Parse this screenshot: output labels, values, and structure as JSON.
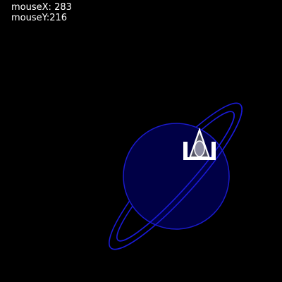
{
  "hud": {
    "mouse_x_label": "mouseX:",
    "mouse_x_value": "283",
    "mouse_y_label": "mouseY:",
    "mouse_y_value": "216"
  },
  "colors": {
    "background": "#000000",
    "planet_fill": "#000046",
    "planet_stroke": "#1a1acc",
    "ring_stroke": "#1a1ad6",
    "ship_body": "#ffffff",
    "ship_core": "#8a8aa0",
    "hud_text": "#ffffff"
  },
  "icons": {
    "planet": "ringed-planet-icon",
    "ship": "spaceship-icon"
  }
}
